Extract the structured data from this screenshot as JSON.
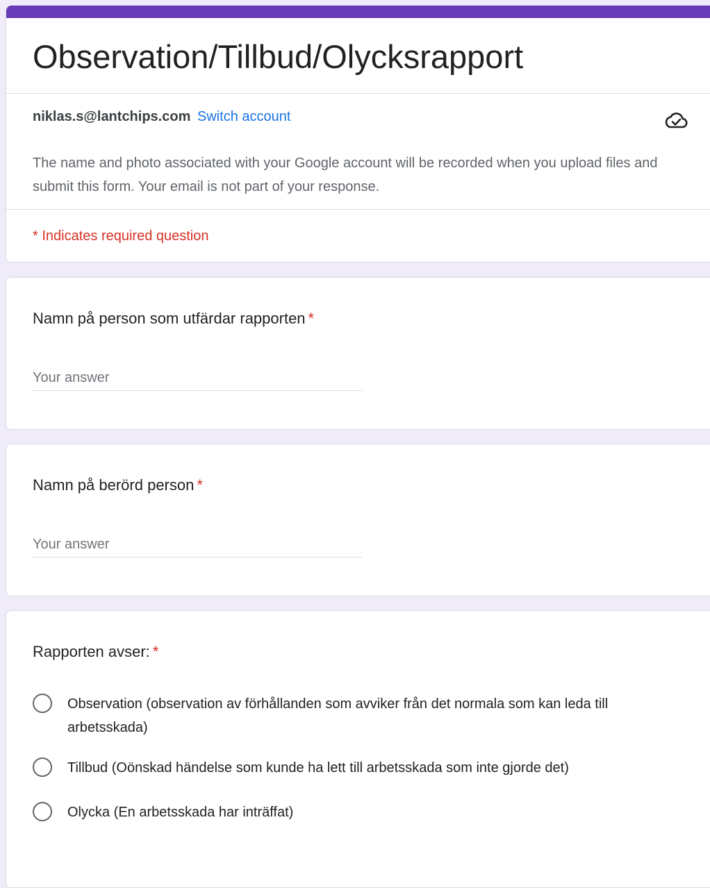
{
  "form": {
    "title": "Observation/Tillbud/Olycksrapport",
    "accent_color": "#673ab7",
    "required_color": "#d93025"
  },
  "account": {
    "email": "niklas.s@lantchips.com",
    "switch_label": "Switch account",
    "icon": "cloud-done-icon",
    "privacy_note": "The name and photo associated with your Google account will be recorded when you upload files and submit this form. Your email is not part of your response."
  },
  "required_note": "* Indicates required question",
  "questions": [
    {
      "title": "Namn på person som utfärdar rapporten",
      "required_mark": "*",
      "placeholder": "Your answer"
    },
    {
      "title": "Namn på berörd person",
      "required_mark": "*",
      "placeholder": "Your answer"
    },
    {
      "title": "Rapporten avser:",
      "required_mark": "*",
      "options": [
        "Observation (observation av förhållanden som avviker från det normala som kan leda till arbetsskada)",
        "Tillbud (Oönskad händelse som kunde ha lett till arbetsskada som inte gjorde det)",
        "Olycka (En arbetsskada har inträffat)"
      ]
    }
  ]
}
